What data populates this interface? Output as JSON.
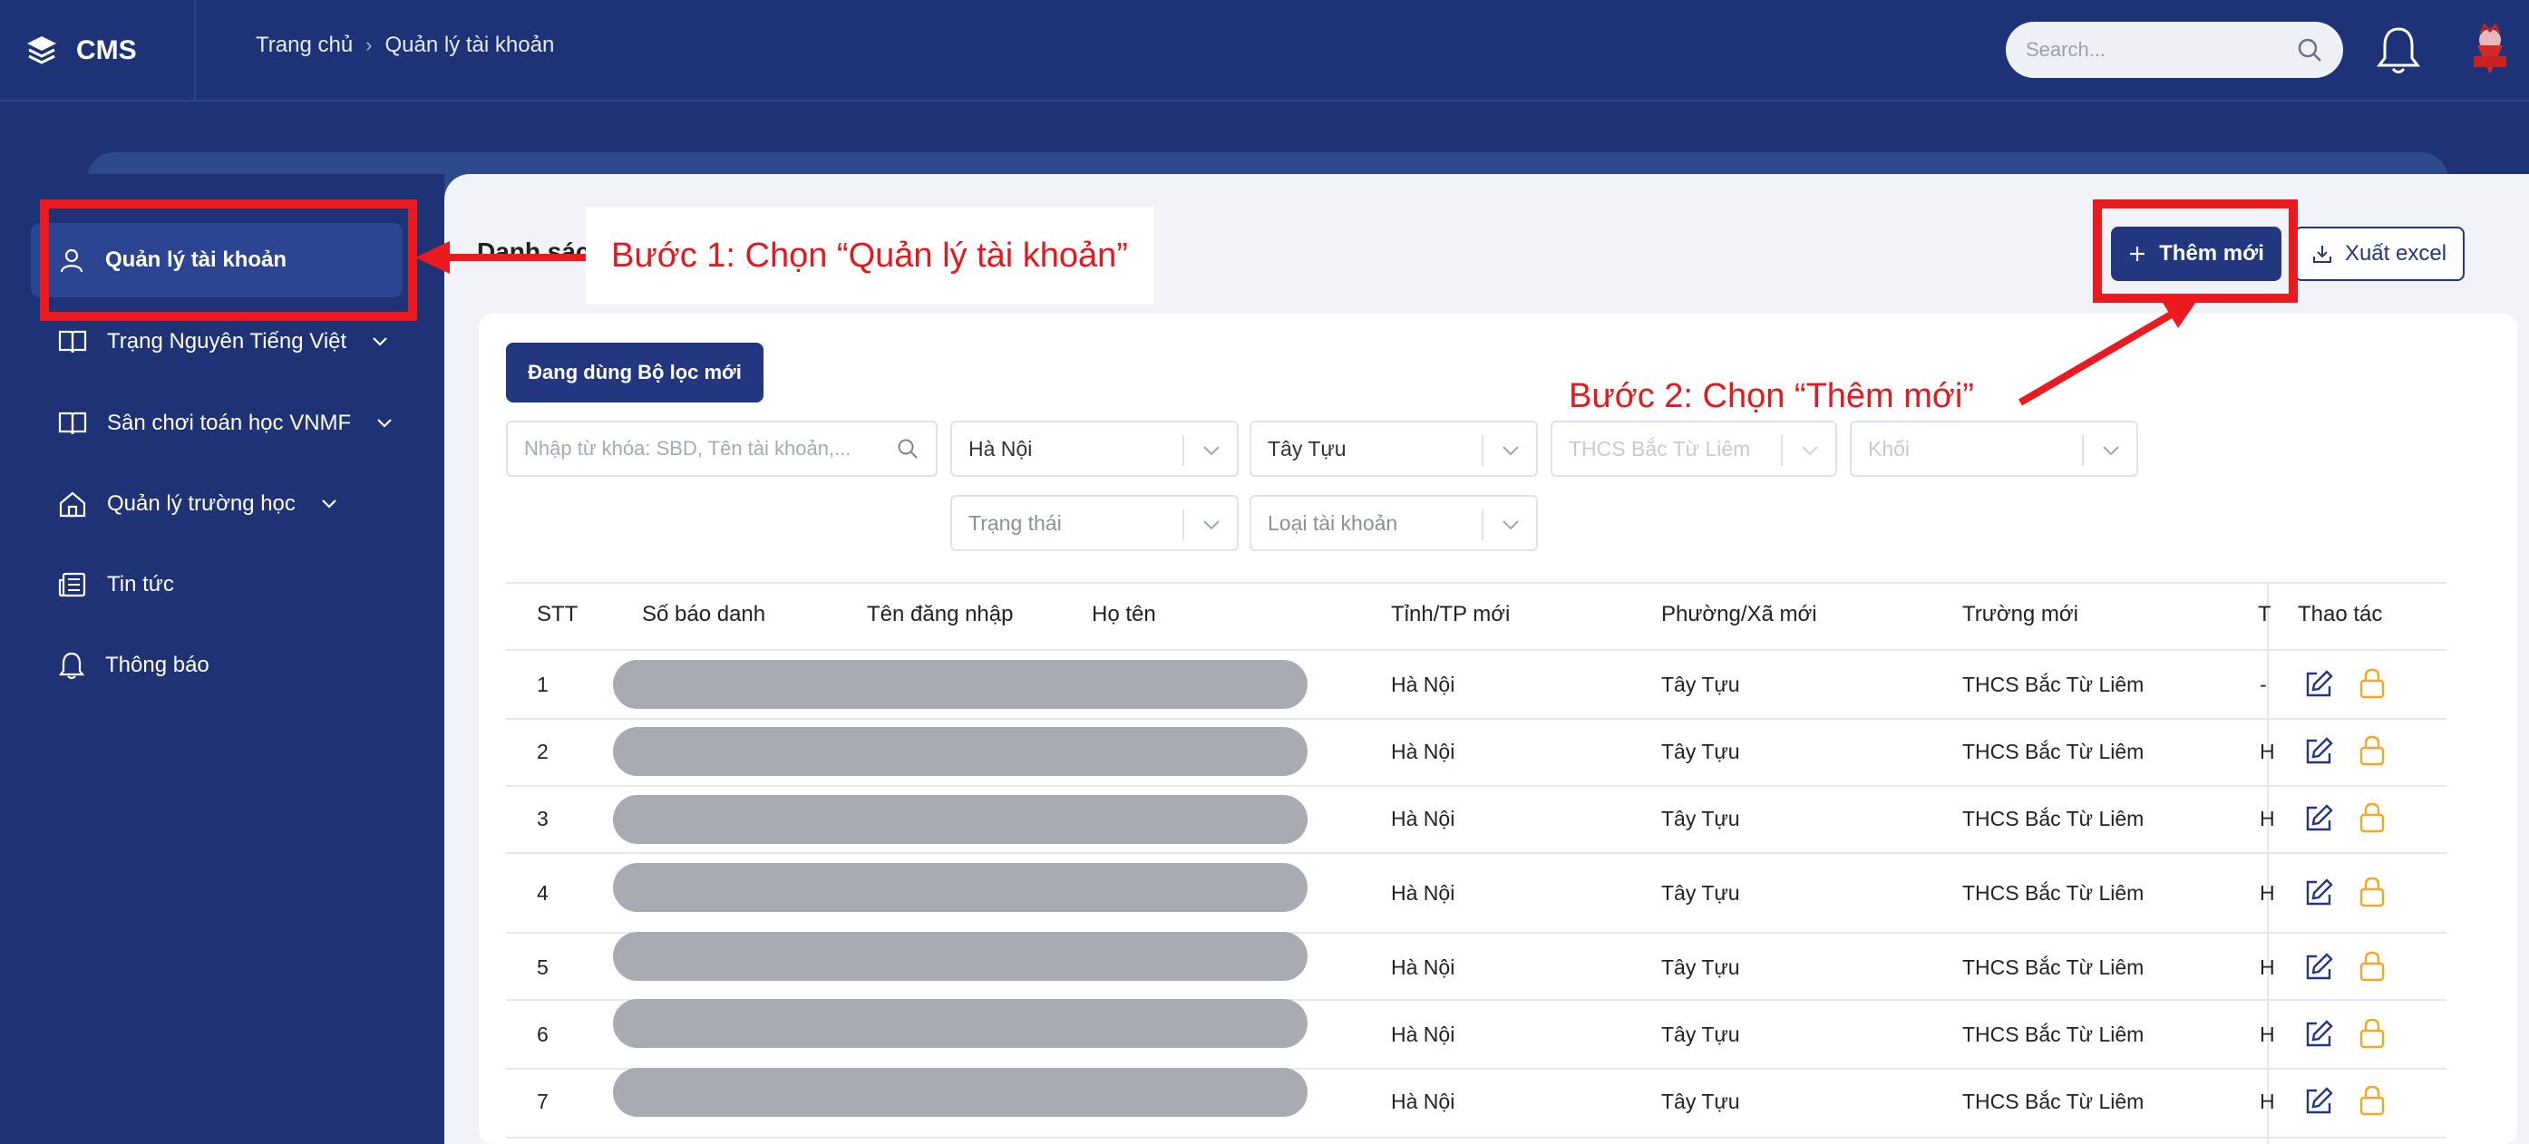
{
  "header": {
    "brand": "CMS",
    "breadcrumb": [
      "Trang chủ",
      "Quản lý tài khoản"
    ],
    "search_placeholder": "Search..."
  },
  "sidebar": {
    "items": [
      {
        "label": "Quản lý tài khoản",
        "icon": "user-icon",
        "active": true
      },
      {
        "label": "Trạng Nguyên Tiếng Việt",
        "icon": "book-icon",
        "expandable": true
      },
      {
        "label": "Sân chơi toán học VNMF",
        "icon": "book-icon",
        "expandable": true
      },
      {
        "label": "Quản lý trường học",
        "icon": "home-icon",
        "expandable": true
      },
      {
        "label": "Tin tức",
        "icon": "newspaper-icon"
      },
      {
        "label": "Thông báo",
        "icon": "bell-icon"
      }
    ]
  },
  "main": {
    "title": "Danh sác",
    "add_button": "Thêm mới",
    "export_button": "Xuất excel",
    "filter_toggle": "Đang dùng Bộ lọc mới",
    "filters": {
      "keyword_placeholder": "Nhập từ khóa: SBD, Tên tài khoản,...",
      "province": "Hà Nội",
      "ward": "Tây Tựu",
      "school": "THCS Bắc Từ Liêm",
      "grade": "Khối",
      "status": "Trạng thái",
      "account_type": "Loại tài khoản"
    },
    "table": {
      "columns": [
        "STT",
        "Số báo danh",
        "Tên đăng nhập",
        "Họ tên",
        "Tỉnh/TP mới",
        "Phường/Xã mới",
        "Trường mới",
        "T",
        "Thao tác"
      ],
      "rows": [
        {
          "stt": "1",
          "province": "Hà Nội",
          "ward": "Tây Tựu",
          "school": "THCS Bắc Từ Liêm",
          "trunc": "-"
        },
        {
          "stt": "2",
          "province": "Hà Nội",
          "ward": "Tây Tựu",
          "school": "THCS Bắc Từ Liêm",
          "trunc": "H"
        },
        {
          "stt": "3",
          "province": "Hà Nội",
          "ward": "Tây Tựu",
          "school": "THCS Bắc Từ Liêm",
          "trunc": "H"
        },
        {
          "stt": "4",
          "province": "Hà Nội",
          "ward": "Tây Tựu",
          "school": "THCS Bắc Từ Liêm",
          "trunc": "H"
        },
        {
          "stt": "5",
          "province": "Hà Nội",
          "ward": "Tây Tựu",
          "school": "THCS Bắc Từ Liêm",
          "trunc": "H"
        },
        {
          "stt": "6",
          "province": "Hà Nội",
          "ward": "Tây Tựu",
          "school": "THCS Bắc Từ Liêm",
          "trunc": "H"
        },
        {
          "stt": "7",
          "province": "Hà Nội",
          "ward": "Tây Tựu",
          "school": "THCS Bắc Từ Liêm",
          "trunc": "H"
        }
      ]
    }
  },
  "annotations": {
    "step1": "Bước 1: Chọn “Quản lý tài khoản”",
    "step2": "Bước 2: Chọn “Thêm mới”"
  },
  "colors": {
    "navy": "#1f3275",
    "primary_button": "#22377f",
    "annotation_red": "#ea1a1f",
    "lock_icon": "#f5a623",
    "redaction": "#a9abb3"
  }
}
